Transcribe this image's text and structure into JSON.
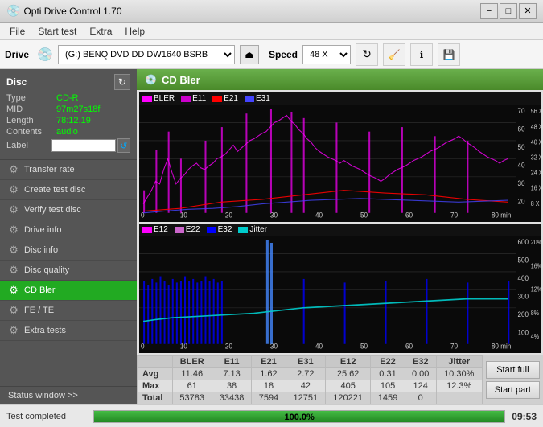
{
  "titleBar": {
    "title": "Opti Drive Control 1.70",
    "minimizeLabel": "−",
    "maximizeLabel": "□",
    "closeLabel": "✕",
    "iconLabel": "💿"
  },
  "menuBar": {
    "items": [
      "File",
      "Start test",
      "Extra",
      "Help"
    ]
  },
  "driveBar": {
    "label": "Drive",
    "driveValue": "(G:)  BENQ DVD DD DW1640 BSRB",
    "ejectLabel": "⏏",
    "speedLabel": "Speed",
    "speedValue": "48 X",
    "refreshLabel": "↻",
    "clearLabel": "🧹",
    "infoLabel": "ℹ",
    "saveLabel": "💾"
  },
  "disc": {
    "title": "Disc",
    "refreshLabel": "↻",
    "fields": [
      {
        "key": "Type",
        "value": "CD-R",
        "green": true
      },
      {
        "key": "MID",
        "value": "97m27s18f",
        "green": true
      },
      {
        "key": "Length",
        "value": "78:12.19",
        "green": true
      },
      {
        "key": "Contents",
        "value": "audio",
        "green": true
      },
      {
        "key": "Label",
        "value": "",
        "green": false
      }
    ]
  },
  "sidebar": {
    "items": [
      {
        "id": "transfer-rate",
        "label": "Transfer rate",
        "icon": "⚙"
      },
      {
        "id": "create-test-disc",
        "label": "Create test disc",
        "icon": "⚙"
      },
      {
        "id": "verify-test-disc",
        "label": "Verify test disc",
        "icon": "⚙"
      },
      {
        "id": "drive-info",
        "label": "Drive info",
        "icon": "⚙"
      },
      {
        "id": "disc-info",
        "label": "Disc info",
        "icon": "⚙"
      },
      {
        "id": "disc-quality",
        "label": "Disc quality",
        "icon": "⚙"
      },
      {
        "id": "cd-bler",
        "label": "CD Bler",
        "icon": "⚙",
        "active": true
      },
      {
        "id": "fe-te",
        "label": "FE / TE",
        "icon": "⚙"
      },
      {
        "id": "extra-tests",
        "label": "Extra tests",
        "icon": "⚙"
      }
    ],
    "statusWindowLabel": "Status window >>",
    "testCompleted": "Test completed"
  },
  "chartHeader": {
    "title": "CD Bler",
    "icon": "💿"
  },
  "chart1": {
    "legendItems": [
      {
        "label": "BLER",
        "color": "#ff00ff"
      },
      {
        "label": "E11",
        "color": "#cc00cc"
      },
      {
        "label": "E21",
        "color": "#ff0000"
      },
      {
        "label": "E31",
        "color": "#0000ff"
      }
    ],
    "yAxisMax": 70,
    "yAxisRight": [
      "56 X",
      "48 X",
      "40 X",
      "32 X",
      "24 X",
      "16 X",
      "8 X"
    ]
  },
  "chart2": {
    "legendItems": [
      {
        "label": "E12",
        "color": "#ff00ff"
      },
      {
        "label": "E22",
        "color": "#cc66cc"
      },
      {
        "label": "E32",
        "color": "#0000ff"
      },
      {
        "label": "Jitter",
        "color": "#00cccc"
      }
    ],
    "yAxisMax": 600,
    "yAxisRight": [
      "20%",
      "16%",
      "12%",
      "8%",
      "4%"
    ]
  },
  "stats": {
    "columns": [
      "",
      "BLER",
      "E11",
      "E21",
      "E31",
      "E12",
      "E22",
      "E32",
      "Jitter"
    ],
    "rows": [
      {
        "label": "Avg",
        "values": [
          "11.46",
          "7.13",
          "1.62",
          "2.72",
          "25.62",
          "0.31",
          "0.00",
          "10.30%"
        ]
      },
      {
        "label": "Max",
        "values": [
          "61",
          "38",
          "18",
          "42",
          "405",
          "105",
          "124",
          "12.3%"
        ]
      },
      {
        "label": "Total",
        "values": [
          "53783",
          "33438",
          "7594",
          "12751",
          "120221",
          "1459",
          "0",
          ""
        ]
      }
    ]
  },
  "buttons": {
    "startFull": "Start full",
    "startPart": "Start part"
  },
  "statusBar": {
    "text": "Test completed",
    "progress": 100.0,
    "progressLabel": "100.0%",
    "time": "09:53"
  }
}
